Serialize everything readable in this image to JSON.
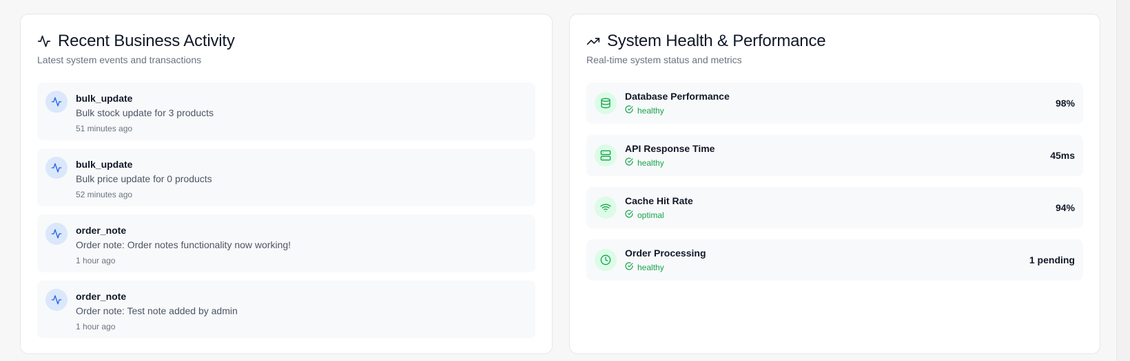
{
  "activity_card": {
    "title": "Recent Business Activity",
    "subtitle": "Latest system events and transactions",
    "header_icon": "activity-icon",
    "items": [
      {
        "type": "bulk_update",
        "description": "Bulk stock update for 3 products",
        "time": "51 minutes ago",
        "icon": "activity-icon"
      },
      {
        "type": "bulk_update",
        "description": "Bulk price update for 0 products",
        "time": "52 minutes ago",
        "icon": "activity-icon"
      },
      {
        "type": "order_note",
        "description": "Order note: Order notes functionality now working!",
        "time": "1 hour ago",
        "icon": "activity-icon"
      },
      {
        "type": "order_note",
        "description": "Order note: Test note added by admin",
        "time": "1 hour ago",
        "icon": "activity-icon"
      }
    ]
  },
  "health_card": {
    "title": "System Health & Performance",
    "subtitle": "Real-time system status and metrics",
    "header_icon": "trending-up-icon",
    "metrics": [
      {
        "name": "Database Performance",
        "status": "healthy",
        "value": "98%",
        "icon": "database-icon"
      },
      {
        "name": "API Response Time",
        "status": "healthy",
        "value": "45ms",
        "icon": "server-icon"
      },
      {
        "name": "Cache Hit Rate",
        "status": "optimal",
        "value": "94%",
        "icon": "wifi-icon"
      },
      {
        "name": "Order Processing",
        "status": "healthy",
        "value": "1 pending",
        "icon": "clock-icon"
      }
    ]
  },
  "colors": {
    "activity_icon_bg": "#dbe7fb",
    "activity_icon_stroke": "#2563eb",
    "metric_icon_bg": "#dcfce7",
    "metric_icon_stroke": "#16a34a",
    "status_text": "#16a34a"
  }
}
